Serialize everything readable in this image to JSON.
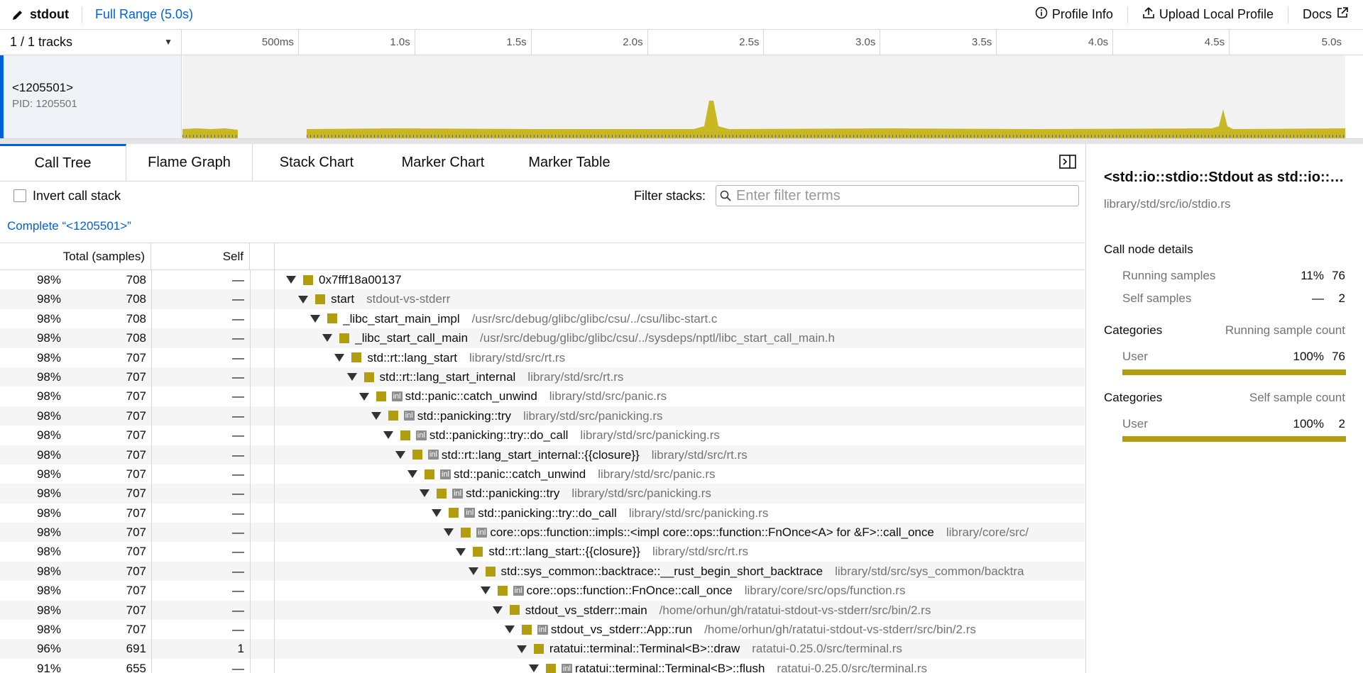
{
  "topbar": {
    "app_name": "stdout",
    "range": "Full Range (5.0s)",
    "profile_info": "Profile Info",
    "upload": "Upload Local Profile",
    "docs": "Docs"
  },
  "timeline": {
    "track_count": "1 / 1 tracks",
    "ticks": [
      "500ms",
      "1.0s",
      "1.5s",
      "2.0s",
      "2.5s",
      "3.0s",
      "3.5s",
      "4.0s",
      "4.5s",
      "5.0s"
    ],
    "track_name": "<1205501>",
    "track_pid": "PID: 1205501"
  },
  "tabs": [
    "Call Tree",
    "Flame Graph",
    "Stack Chart",
    "Marker Chart",
    "Marker Table"
  ],
  "settings": {
    "invert_label": "Invert call stack",
    "filter_label": "Filter stacks:",
    "filter_placeholder": "Enter filter terms"
  },
  "breadcrumb": "Complete “<1205501>”",
  "columns": {
    "total": "Total (samples)",
    "self": "Self"
  },
  "rows": [
    {
      "pct": "98%",
      "total": "708",
      "self": "—",
      "depth": 0,
      "inl": false,
      "name": "0x7fff18a00137",
      "lib": ""
    },
    {
      "pct": "98%",
      "total": "708",
      "self": "—",
      "depth": 1,
      "inl": false,
      "name": "start",
      "lib": "stdout-vs-stderr"
    },
    {
      "pct": "98%",
      "total": "708",
      "self": "—",
      "depth": 2,
      "inl": false,
      "name": "_libc_start_main_impl",
      "lib": "/usr/src/debug/glibc/glibc/csu/../csu/libc-start.c"
    },
    {
      "pct": "98%",
      "total": "708",
      "self": "—",
      "depth": 3,
      "inl": false,
      "name": "_libc_start_call_main",
      "lib": "/usr/src/debug/glibc/glibc/csu/../sysdeps/nptl/libc_start_call_main.h"
    },
    {
      "pct": "98%",
      "total": "707",
      "self": "—",
      "depth": 4,
      "inl": false,
      "name": "std::rt::lang_start",
      "lib": "library/std/src/rt.rs"
    },
    {
      "pct": "98%",
      "total": "707",
      "self": "—",
      "depth": 5,
      "inl": false,
      "name": "std::rt::lang_start_internal",
      "lib": "library/std/src/rt.rs"
    },
    {
      "pct": "98%",
      "total": "707",
      "self": "—",
      "depth": 6,
      "inl": true,
      "name": "std::panic::catch_unwind",
      "lib": "library/std/src/panic.rs"
    },
    {
      "pct": "98%",
      "total": "707",
      "self": "—",
      "depth": 7,
      "inl": true,
      "name": "std::panicking::try",
      "lib": "library/std/src/panicking.rs"
    },
    {
      "pct": "98%",
      "total": "707",
      "self": "—",
      "depth": 8,
      "inl": true,
      "name": "std::panicking::try::do_call",
      "lib": "library/std/src/panicking.rs"
    },
    {
      "pct": "98%",
      "total": "707",
      "self": "—",
      "depth": 9,
      "inl": true,
      "name": "std::rt::lang_start_internal::{{closure}}",
      "lib": "library/std/src/rt.rs"
    },
    {
      "pct": "98%",
      "total": "707",
      "self": "—",
      "depth": 10,
      "inl": true,
      "name": "std::panic::catch_unwind",
      "lib": "library/std/src/panic.rs"
    },
    {
      "pct": "98%",
      "total": "707",
      "self": "—",
      "depth": 11,
      "inl": true,
      "name": "std::panicking::try",
      "lib": "library/std/src/panicking.rs"
    },
    {
      "pct": "98%",
      "total": "707",
      "self": "—",
      "depth": 12,
      "inl": true,
      "name": "std::panicking::try::do_call",
      "lib": "library/std/src/panicking.rs"
    },
    {
      "pct": "98%",
      "total": "707",
      "self": "—",
      "depth": 13,
      "inl": true,
      "name": "core::ops::function::impls::<impl core::ops::function::FnOnce<A> for &F>::call_once",
      "lib": "library/core/src/"
    },
    {
      "pct": "98%",
      "total": "707",
      "self": "—",
      "depth": 14,
      "inl": false,
      "name": "std::rt::lang_start::{{closure}}",
      "lib": "library/std/src/rt.rs"
    },
    {
      "pct": "98%",
      "total": "707",
      "self": "—",
      "depth": 15,
      "inl": false,
      "name": "std::sys_common::backtrace::__rust_begin_short_backtrace",
      "lib": "library/std/src/sys_common/backtra"
    },
    {
      "pct": "98%",
      "total": "707",
      "self": "—",
      "depth": 16,
      "inl": true,
      "name": "core::ops::function::FnOnce::call_once",
      "lib": "library/core/src/ops/function.rs"
    },
    {
      "pct": "98%",
      "total": "707",
      "self": "—",
      "depth": 17,
      "inl": false,
      "name": "stdout_vs_stderr::main",
      "lib": "/home/orhun/gh/ratatui-stdout-vs-stderr/src/bin/2.rs"
    },
    {
      "pct": "98%",
      "total": "707",
      "self": "—",
      "depth": 18,
      "inl": true,
      "name": "stdout_vs_stderr::App::run",
      "lib": "/home/orhun/gh/ratatui-stdout-vs-stderr/src/bin/2.rs"
    },
    {
      "pct": "96%",
      "total": "691",
      "self": "1",
      "depth": 19,
      "inl": false,
      "name": "ratatui::terminal::Terminal<B>::draw",
      "lib": "ratatui-0.25.0/src/terminal.rs"
    },
    {
      "pct": "91%",
      "total": "655",
      "self": "—",
      "depth": 20,
      "inl": true,
      "name": "ratatui::terminal::Terminal<B>::flush",
      "lib": "ratatui-0.25.0/src/terminal.rs"
    }
  ],
  "sidebar": {
    "title": "<std::io::stdio::Stdout as std::io::Write>::write_fmt",
    "lib": "library/std/src/io/stdio.rs",
    "details_heading": "Call node details",
    "running_label": "Running samples",
    "running_pct": "11%",
    "running_val": "76",
    "self_label": "Self samples",
    "self_pct": "—",
    "self_val": "2",
    "cat1_heading": "Categories",
    "cat1_right": "Running sample count",
    "cat1_name": "User",
    "cat1_pct": "100%",
    "cat1_val": "76",
    "cat1_fill": 1.0,
    "cat2_heading": "Categories",
    "cat2_right": "Self sample count",
    "cat2_name": "User",
    "cat2_pct": "100%",
    "cat2_val": "2",
    "cat2_fill": 1.0
  },
  "colors": {
    "accent": "#0060df",
    "user_category": "#b19d0e",
    "graph_fill": "#c9b824"
  }
}
